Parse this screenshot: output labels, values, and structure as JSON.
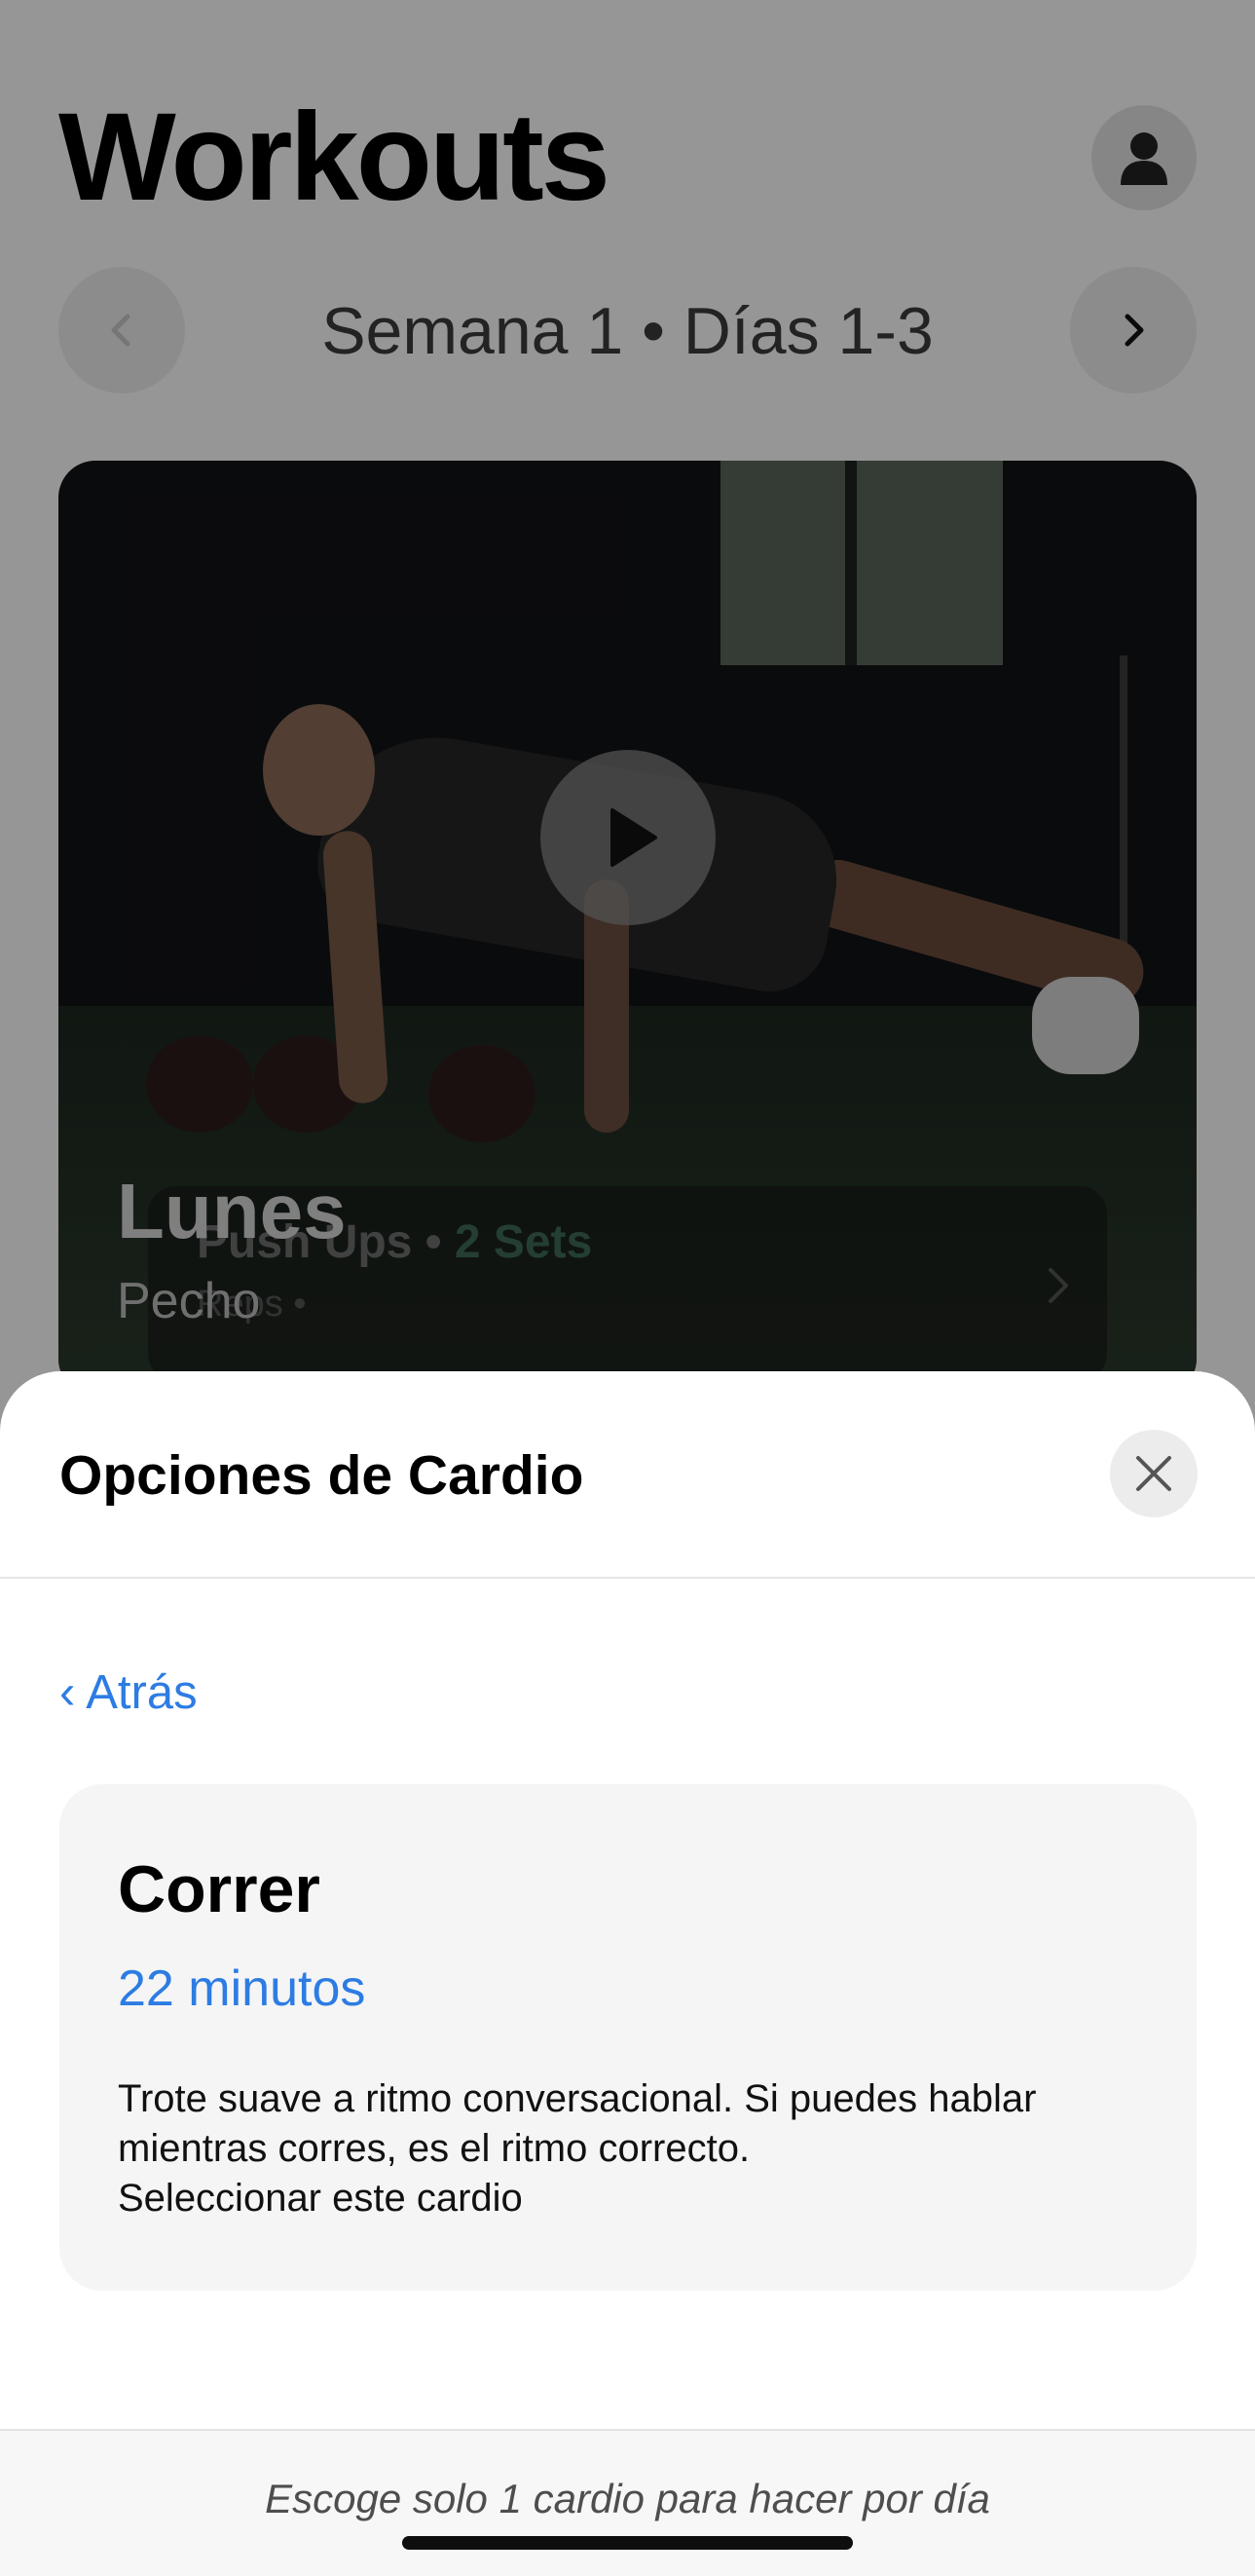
{
  "page": {
    "title": "Workouts",
    "avatar_icon": "person-icon"
  },
  "week_nav": {
    "label": "Semana 1 • Días 1-3",
    "prev_icon": "chevron-left-icon",
    "next_icon": "chevron-right-icon"
  },
  "video_card": {
    "day": "Lunes",
    "muscle_group": "Pecho",
    "exercise_name": "Push Ups",
    "exercise_separator": " • ",
    "exercise_sets": "2 Sets",
    "exercise_reps": "Reps •",
    "play_icon": "play-icon"
  },
  "sheet": {
    "title": "Opciones de Cardio",
    "close_icon": "close-icon",
    "back_label": "‹ Atrás",
    "option": {
      "title": "Correr",
      "duration": "22 minutos",
      "description": "Trote suave a ritmo conversacional. Si puedes hablar mientras corres, es el ritmo correcto.",
      "select_label": "Seleccionar este cardio"
    },
    "footer_note": "Escoge solo 1 cardio para hacer por día"
  },
  "colors": {
    "accent": "#2d7ce3",
    "card_background": "#f5f5f5",
    "overlay": "rgba(0,0,0,0.41)"
  }
}
